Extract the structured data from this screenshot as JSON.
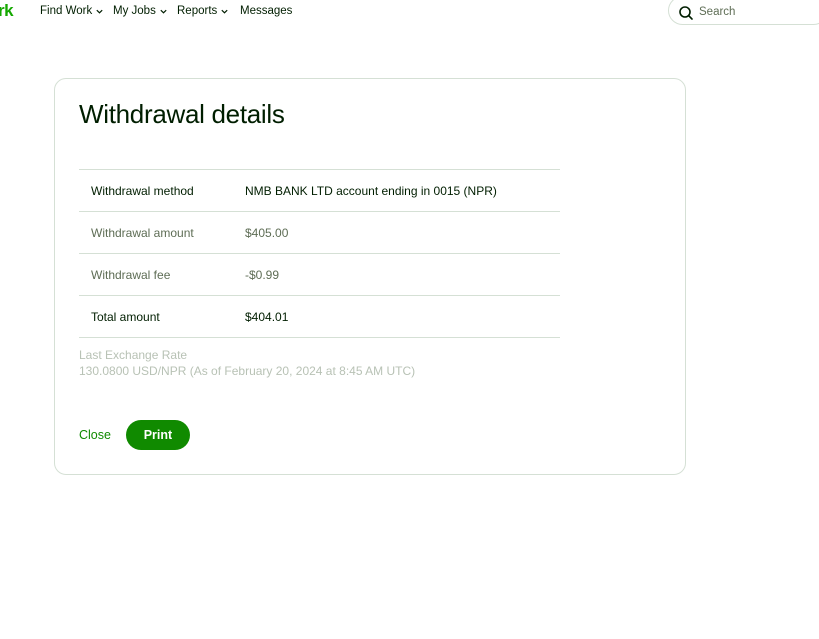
{
  "nav": {
    "logo_text": "rk",
    "items": [
      {
        "label": "Find Work"
      },
      {
        "label": "My Jobs"
      },
      {
        "label": "Reports"
      },
      {
        "label": "Messages"
      }
    ],
    "search_placeholder": "Search"
  },
  "dialog": {
    "title": "Withdrawal details",
    "rows": [
      {
        "label": "Withdrawal method",
        "value": "NMB BANK LTD account ending in 0015 (NPR)"
      },
      {
        "label": "Withdrawal amount",
        "value": "$405.00"
      },
      {
        "label": "Withdrawal fee",
        "value": "-$0.99"
      },
      {
        "label": "Total amount",
        "value": "$404.01"
      }
    ],
    "exchange_rate_label": "Last Exchange Rate",
    "exchange_rate_value": "130.0800 USD/NPR (As of February 20, 2024 at 8:45 AM UTC)",
    "close_label": "Close",
    "print_label": "Print"
  },
  "colors": {
    "brand_green": "#14a800",
    "button_green": "#108a00",
    "text_dark": "#001e00",
    "text_muted": "#5e6d55",
    "border": "#d5e0d5"
  }
}
